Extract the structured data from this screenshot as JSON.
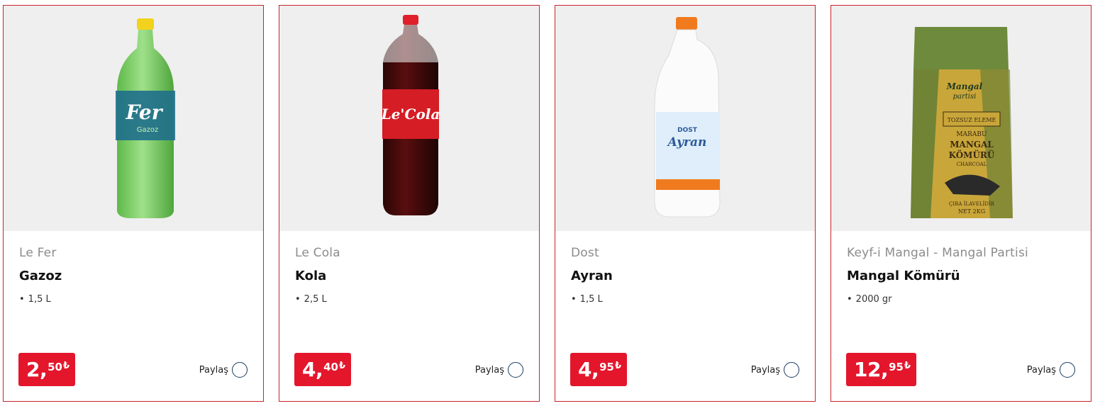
{
  "share_label": "Paylaş",
  "accent_color": "#e3162c",
  "products": [
    {
      "image_icon": "green-soda-bottle",
      "bottle_label": "Fer",
      "bottle_sublabel": "Gazoz",
      "brand": "Le Fer",
      "name": "Gazoz",
      "spec": "1,5 L",
      "price_int": "2,",
      "price_dec": "50",
      "currency": "₺"
    },
    {
      "image_icon": "cola-bottle",
      "bottle_label": "Le'Cola",
      "brand": "Le Cola",
      "name": "Kola",
      "spec": "2,5 L",
      "price_int": "4,",
      "price_dec": "40",
      "currency": "₺"
    },
    {
      "image_icon": "ayran-bottle",
      "bottle_label": "Ayran",
      "bottle_sublabel": "DOST",
      "brand": "Dost",
      "name": "Ayran",
      "spec": "1,5 L",
      "price_int": "4,",
      "price_dec": "95",
      "currency": "₺"
    },
    {
      "image_icon": "charcoal-bag",
      "bag_lines": [
        "Mangal",
        "partisi",
        "TOZSUZ ELEME",
        "MARABU",
        "MANGAL",
        "KÖMÜRÜ",
        "CHARCOAL",
        "ÇIRA İLAVELİDİR",
        "NET 2KG"
      ],
      "brand": "Keyf-i Mangal - Mangal Partisi",
      "name": "Mangal Kömürü",
      "spec": "2000 gr",
      "price_int": "12,",
      "price_dec": "95",
      "currency": "₺"
    }
  ]
}
